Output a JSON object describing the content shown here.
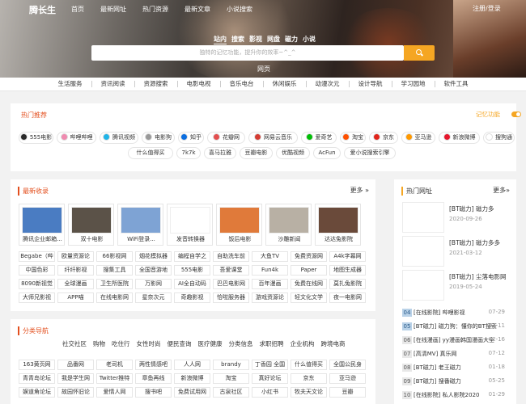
{
  "brand": "腾长生",
  "top_nav": [
    "首页",
    "最新网址",
    "热门资源",
    "最新文章",
    "小说搜索"
  ],
  "login": "注册/登录",
  "search_tabs": [
    "站内",
    "搜索",
    "影视",
    "网盘",
    "磁力",
    "小说"
  ],
  "search_placeholder": "独特的记忆功能，提升你的效率~^_^",
  "hero_sub": "网页",
  "categories": [
    "生活服务",
    "资讯阅读",
    "资源搜索",
    "电影电视",
    "音乐电台",
    "休闲娱乐",
    "动漫次元",
    "设计导航",
    "学习园地",
    "软件工具"
  ],
  "hot": {
    "title": "热门推荐",
    "memo": "记忆功能",
    "row1": [
      {
        "label": "555电影",
        "color": "#2a2a2a"
      },
      {
        "label": "哔哩哔哩",
        "color": "#f08bb0"
      },
      {
        "label": "腾讯视频",
        "color": "#1fb4e8"
      },
      {
        "label": "电影狗",
        "color": "#999999"
      },
      {
        "label": "知乎",
        "color": "#0b6ee0"
      },
      {
        "label": "花瓣网",
        "color": "#e34f4f"
      },
      {
        "label": "网易云音乐",
        "color": "#d43c33"
      },
      {
        "label": "爱奇艺",
        "color": "#00be06"
      },
      {
        "label": "淘宝",
        "color": "#ff5000"
      },
      {
        "label": "京东",
        "color": "#e1251b"
      },
      {
        "label": "亚马逊",
        "color": "#ff9900"
      },
      {
        "label": "新浪微博",
        "color": "#e6162d"
      },
      {
        "label": "搜狗通",
        "color": "#ffffff"
      }
    ],
    "row2": [
      "什么值得买",
      "7k7k",
      "喜马拉雅",
      "豆瓣电影",
      "优酷视频",
      "AcFun",
      "爱小说搜索引擎"
    ]
  },
  "recent": {
    "title": "最新收录",
    "more": "更多 »",
    "cards": [
      {
        "caption": "腾讯企业邮箱...",
        "color": "#4a7cc2"
      },
      {
        "caption": "双十电影",
        "color": "#5b5248"
      },
      {
        "caption": "WiFi登录...",
        "color": "#7ea3d4"
      },
      {
        "caption": "发音转换器",
        "color": "#ffffff"
      },
      {
        "caption": "饭后电影",
        "color": "#e07a3a"
      },
      {
        "caption": "沙雕新闻",
        "color": "#b8b0a4"
      },
      {
        "caption": "达达兔影院",
        "color": "#6a4a3a"
      }
    ],
    "grid": [
      [
        "Begabe（哔",
        "欧量资源论",
        "66影视网",
        "烟花模拟器",
        "编程自学之",
        "自助洗车前",
        "大鱼TV",
        "免费资源网",
        "A4k字幕网"
      ],
      [
        "中国色彩",
        "纤纤影视",
        "搜集工具",
        "全国音游地",
        "555电影",
        "吾爱课堂",
        "Fun4k",
        "Paper",
        "地图生成器"
      ],
      [
        "8090新视觉",
        "全球漫画",
        "卫生所医院",
        "万影网",
        "AI全自动码",
        "巴巴电影网",
        "百年漫画",
        "免费在线网",
        "莫扎兔影院"
      ],
      [
        "大师兄影视",
        "APP喵",
        "在线电影网",
        "星奈次元",
        "奇趣影视",
        "恰啦服务器",
        "游戏资源论",
        "轻文化文学",
        "夜一电影网"
      ]
    ]
  },
  "cat": {
    "title": "分类导航",
    "tabs": [
      "社交社区",
      "购物",
      "吃住行",
      "女性时尚",
      "便民查询",
      "医疗健康",
      "分类信息",
      "求职招聘",
      "企业机构",
      "跨境电商"
    ],
    "grid": [
      [
        "163黄页网",
        "品番网",
        "老司机",
        "两性情感吧",
        "人人网",
        "brandy",
        "丁香园 全国",
        "什么值得买",
        "全国公民身"
      ],
      [
        "青青岛论坛",
        "我是学生网",
        "Twitter推特",
        "章鱼再线",
        "新浪微博",
        "淘宝",
        "真好论坛",
        "京东",
        "亚马逊"
      ],
      [
        "娱道角论坛",
        "故园怀旧论",
        "爱情人网",
        "搜书吧",
        "免费试用网",
        "古泉社区",
        "小红书",
        "牧夫天文论",
        "豆瓣"
      ]
    ]
  },
  "hot_sites": {
    "title": "热门网址",
    "more": "更多»",
    "items": [
      {
        "title": "[BT磁力] 磁力多",
        "date": "2020-09-26"
      },
      {
        "title": "[BT磁力] 磁力多多",
        "date": "2021-03-12"
      },
      {
        "title": "[BT磁力] 尘落电影网",
        "date": "2019-05-24"
      }
    ],
    "ranks": [
      {
        "n": "04",
        "title": "[在线影院] 哔哩影视",
        "date": "07-29"
      },
      {
        "n": "05",
        "title": "[BT磁力] 磁力狗：懂你的BT搜索",
        "date": "03-11"
      },
      {
        "n": "06",
        "title": "[在线漫画] yy漫画韩国漫画大全",
        "date": "02-16"
      },
      {
        "n": "07",
        "title": "[高清MV] 真乐网",
        "date": "07-12"
      },
      {
        "n": "08",
        "title": "[BT磁力] 老王磁力",
        "date": "01-18"
      },
      {
        "n": "09",
        "title": "[BT磁力] 搜番磁力",
        "date": "05-25"
      },
      {
        "n": "10",
        "title": "[在线影院] 私人影院2020",
        "date": "01-29"
      }
    ]
  },
  "colors": {
    "accent": "#e34f1e",
    "search_button": "#f5a623",
    "memo": "#f5a623"
  }
}
